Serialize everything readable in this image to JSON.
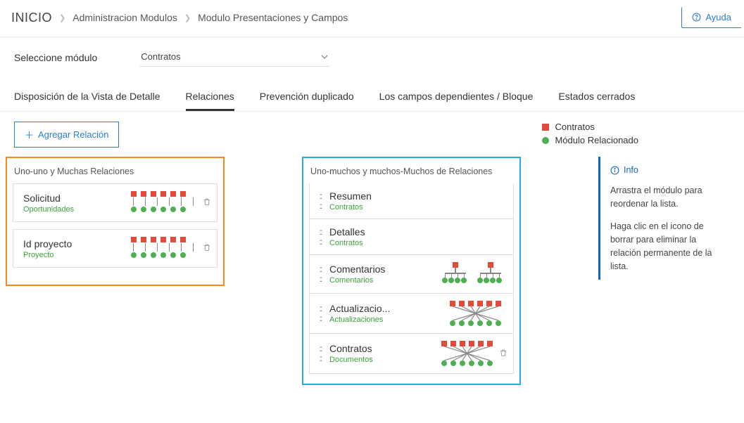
{
  "breadcrumb": {
    "home": "INICIO",
    "l1": "Administracion Modulos",
    "l2": "Modulo Presentaciones y Campos"
  },
  "help_label": "Ayuda",
  "selector": {
    "label": "Seleccione módulo",
    "value": "Contratos"
  },
  "tabs": {
    "t0": "Disposición de la Vista de Detalle",
    "t1": "Relaciones",
    "t2": "Prevención duplicado",
    "t3": "Los campos dependientes / Bloque",
    "t4": "Estados cerrados"
  },
  "add_relation_label": "Agregar Relación",
  "legend": {
    "a": "Contratos",
    "b": "Módulo Relacionado"
  },
  "left": {
    "title": "Uno-uno y Muchas Relaciones",
    "items": [
      {
        "title": "Solicitud",
        "sub": "Oportunidades"
      },
      {
        "title": "Id proyecto",
        "sub": "Proyecto"
      }
    ]
  },
  "mid": {
    "title": "Uno-muchos y muchos-Muchos de Relaciones",
    "items": [
      {
        "title": "Resumen",
        "sub": "Contratos",
        "diagram": "none",
        "trash": false
      },
      {
        "title": "Detalles",
        "sub": "Contratos",
        "diagram": "none",
        "trash": false
      },
      {
        "title": "Comentarios",
        "sub": "Comentarios",
        "diagram": "tree",
        "trash": false
      },
      {
        "title": "Actualizacio...",
        "sub": "Actualizaciones",
        "diagram": "cross",
        "trash": false
      },
      {
        "title": "Contratos",
        "sub": "Documentos",
        "diagram": "cross",
        "trash": true
      }
    ]
  },
  "info": {
    "title": "Info",
    "p1": "Arrastra el módulo para reordenar la lista.",
    "p2": "Haga clic en el icono de borrar para eliminar la relación permanente de la lista."
  }
}
